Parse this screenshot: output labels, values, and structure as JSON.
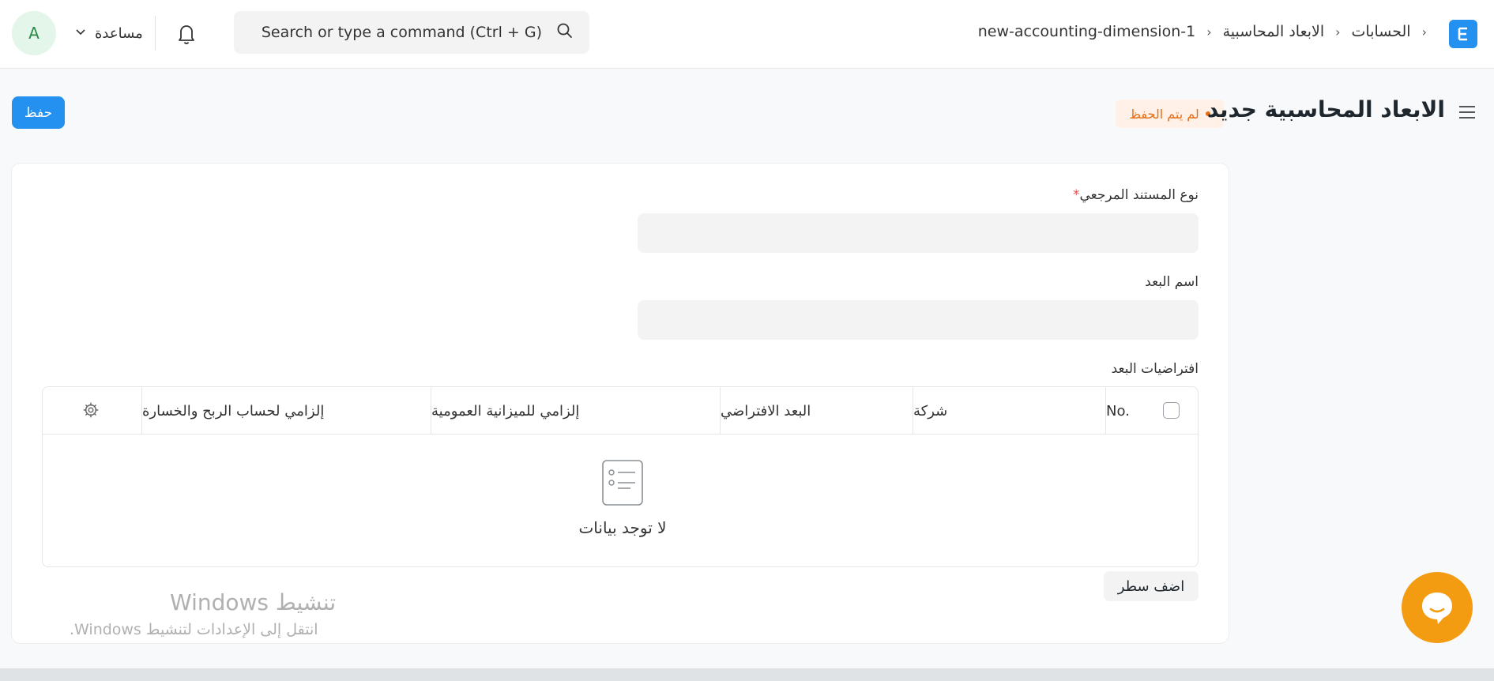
{
  "navbar": {
    "avatar_letter": "A",
    "help_label": "مساعدة",
    "search_placeholder": "Search or type a command (Ctrl + G)",
    "breadcrumb": [
      "new-accounting-dimension-1",
      "الابعاد المحاسبية",
      "الحسابات"
    ],
    "logo_letter": "E"
  },
  "page": {
    "title": "الابعاد المحاسبية جديد",
    "status": "لم يتم الحفظ",
    "save_label": "حفظ"
  },
  "form": {
    "reference_doctype_label": "نوع المستند المرجعي",
    "reference_doctype_value": "",
    "dimension_name_label": "اسم البعد",
    "dimension_name_value": "",
    "defaults_label": "افتراضيات البعد",
    "table": {
      "columns": [
        "No.",
        "شركة",
        "البعد الافتراضي",
        "إلزامي للميزانية العمومية",
        "إلزامي لحساب الربح والخسارة"
      ],
      "empty_text": "لا توجد بيانات"
    },
    "add_row_label": "اضف سطر"
  },
  "watermark": {
    "title": "تنشيط Windows",
    "subtitle": "انتقل إلى الإعدادات لتنشيط Windows."
  },
  "colors": {
    "primary": "#2490ef",
    "status": "#e86c13",
    "chat": "#f39c12"
  }
}
